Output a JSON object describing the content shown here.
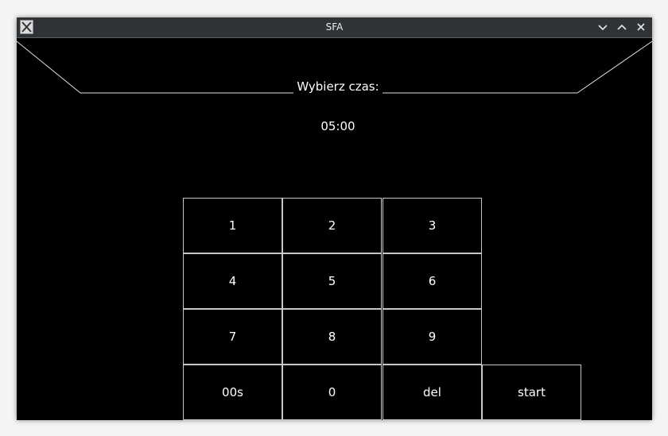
{
  "window": {
    "title": "SFA",
    "buttons": {
      "minimize_icon": "chevron-down-icon",
      "maximize_icon": "chevron-up-icon",
      "close_icon": "close-icon"
    }
  },
  "main": {
    "heading": "Wybierz czas:",
    "time_value": "05:00"
  },
  "keypad": {
    "row1": [
      "1",
      "2",
      "3"
    ],
    "row2": [
      "4",
      "5",
      "6"
    ],
    "row3": [
      "7",
      "8",
      "9"
    ],
    "row4": [
      "00s",
      "0",
      "del",
      "start"
    ]
  },
  "colors": {
    "background": "#000000",
    "foreground": "#ffffff",
    "border": "#c8c8c8",
    "titlebar": "#2f3338"
  }
}
